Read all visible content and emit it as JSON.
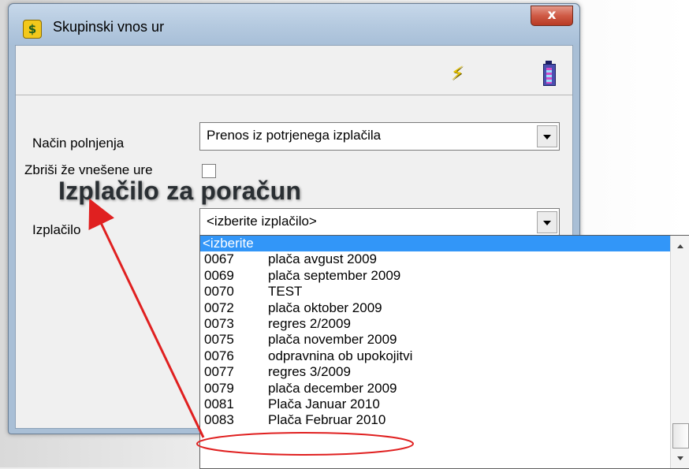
{
  "window": {
    "title": "Skupinski vnos ur",
    "app_icon": "money-bag-icon",
    "close_label": "x"
  },
  "toolbar": {
    "execute_icon": "lightning-bolt-icon",
    "exit_icon": "exit-door-icon"
  },
  "form": {
    "fill_method_label": "Način polnjenja",
    "fill_method_value": "Prenos iz potrjenega izplačila",
    "delete_entered_label": "Zbriši že vnešene ure",
    "delete_entered_checked": false,
    "payout_label": "Izplačilo",
    "payout_value": "<izberite izplačilo>"
  },
  "annotation": {
    "text": "Izplačilo za poračun",
    "arrow_color": "#e02020",
    "circle_color": "#e02020"
  },
  "dropdown": {
    "selected_index": 0,
    "items": [
      {
        "code": "<izberite",
        "name": ""
      },
      {
        "code": "0067",
        "name": "plača avgust 2009"
      },
      {
        "code": "0069",
        "name": "plača september 2009"
      },
      {
        "code": "0070",
        "name": "TEST"
      },
      {
        "code": "0072",
        "name": "plača oktober 2009"
      },
      {
        "code": "0073",
        "name": "regres 2/2009"
      },
      {
        "code": "0075",
        "name": "plača november 2009"
      },
      {
        "code": "0076",
        "name": "odpravnina ob upokojitvi"
      },
      {
        "code": "0077",
        "name": "regres 3/2009"
      },
      {
        "code": "0079",
        "name": "plača december 2009"
      },
      {
        "code": "0081",
        "name": "Plača Januar 2010"
      },
      {
        "code": "0083",
        "name": "Plača Februar 2010"
      }
    ]
  },
  "colors": {
    "selection": "#3296f8",
    "title_bar": "#b4c9df",
    "close_button": "#cf5a45"
  }
}
